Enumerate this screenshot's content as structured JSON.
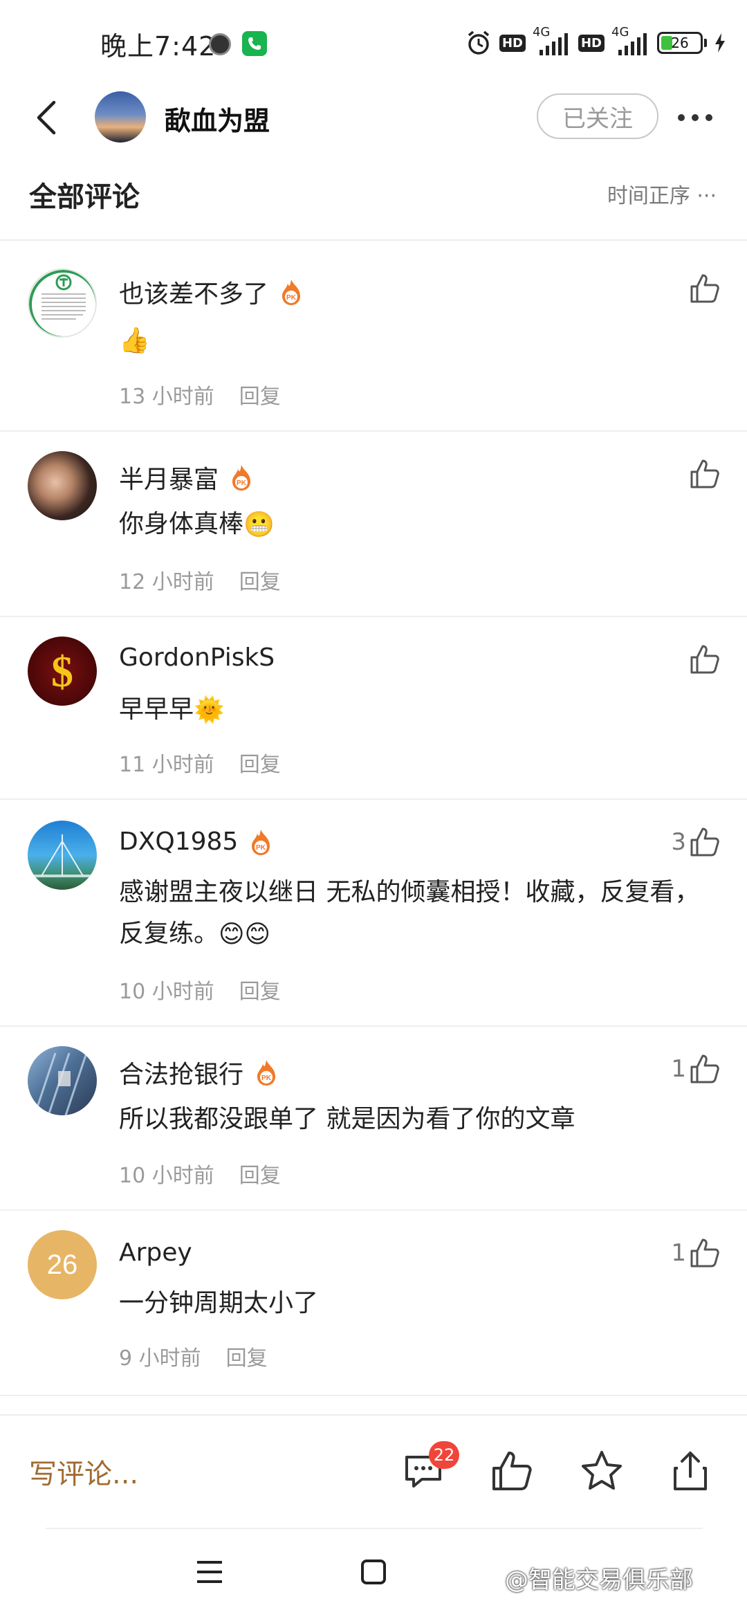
{
  "status_bar": {
    "time": "晚上7:42",
    "network_1": "4G",
    "network_2": "4G",
    "battery": "26",
    "hd_1": "HD",
    "hd_2": "HD"
  },
  "header": {
    "title": "歃血为盟",
    "follow_label": "已关注"
  },
  "section": {
    "title": "全部评论",
    "sort_label": "时间正序 ···"
  },
  "comments": [
    {
      "name": "也该差不多了",
      "text": "",
      "emoji": "👍",
      "time": "13 小时前",
      "reply": "回复",
      "likes": "",
      "has_badge": true
    },
    {
      "name": "半月暴富",
      "text": "你身体真棒",
      "emoji": "😬",
      "time": "12 小时前",
      "reply": "回复",
      "likes": "",
      "has_badge": true
    },
    {
      "name": "GordonPiskS",
      "text": "早早早",
      "emoji": "🌞",
      "time": "11 小时前",
      "reply": "回复",
      "likes": "",
      "has_badge": false
    },
    {
      "name": "DXQ1985",
      "text": "感谢盟主夜以继日 无私的倾囊相授！收藏，反复看，反复练。",
      "emoji": "😊😊",
      "time": "10 小时前",
      "reply": "回复",
      "likes": "3",
      "has_badge": true
    },
    {
      "name": "合法抢银行",
      "text": "所以我都没跟单了 就是因为看了你的文章",
      "emoji": "",
      "time": "10 小时前",
      "reply": "回复",
      "likes": "1",
      "has_badge": true
    },
    {
      "name": "Arpey",
      "text": "一分钟周期太小了",
      "emoji": "",
      "time": "9 小时前",
      "reply": "回复",
      "likes": "1",
      "has_badge": false,
      "avatar_text": "26"
    }
  ],
  "bottom_bar": {
    "write_placeholder": "写评论...",
    "comment_count": "22"
  },
  "watermark": "@智能交易俱乐部",
  "colors": {
    "accent_brown": "#a06b30",
    "badge_red": "#f0453a",
    "fire_orange": "#f07a2a",
    "arpey_avatar": "#e7b566"
  }
}
